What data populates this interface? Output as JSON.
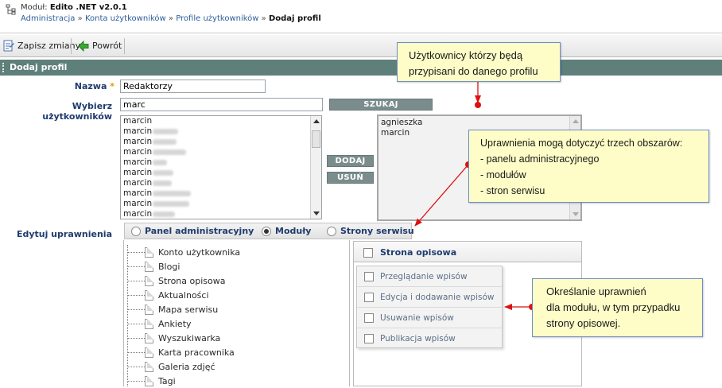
{
  "header": {
    "module_label": "Moduł:",
    "module_name": "Edito .NET v2.0.1",
    "breadcrumbs": [
      "Administracja",
      "Konta użytkowników",
      "Profile użytkowników"
    ],
    "breadcrumb_sep": "»",
    "breadcrumb_current": "Dodaj profil"
  },
  "toolbar": {
    "save_label": "Zapisz zmiany",
    "back_label": "Powrót"
  },
  "section": {
    "title": "Dodaj profil"
  },
  "form": {
    "name_label": "Nazwa",
    "name_required_mark": "*",
    "name_value": "Redaktorzy",
    "users_label": "Wybierz użytkowników",
    "search_value": "marc",
    "search_button": "SZUKAJ",
    "add_button": "DODAJ",
    "remove_button": "USUŃ",
    "available_users": [
      "marcin",
      "marcin",
      "marcin",
      "marcin",
      "marcin",
      "marcin",
      "marcin",
      "marcin",
      "marcin",
      "marcin"
    ],
    "selected_users": [
      "agnieszka",
      "marcin"
    ],
    "permissions_label": "Edytuj uprawnienia"
  },
  "permissions": {
    "options": [
      "Panel administracyjny",
      "Moduły",
      "Strony serwisu"
    ],
    "selected": "Moduły",
    "modules": [
      "Konto użytkownika",
      "Blogi",
      "Strona opisowa",
      "Aktualności",
      "Mapa serwisu",
      "Ankiety",
      "Wyszukiwarka",
      "Karta pracownika",
      "Galeria zdjęć",
      "Tagi"
    ],
    "panel_title": "Strona opisowa",
    "rights": [
      "Przeglądanie wpisów",
      "Edycja i dodawanie wpisów",
      "Usuwanie wpisów",
      "Publikacja wpisów"
    ]
  },
  "callouts": {
    "users": [
      "Użytkownicy którzy będą",
      "przypisani do danego profilu"
    ],
    "areas": [
      "Uprawnienia mogą dotyczyć trzech obszarów:",
      "- panelu administracyjnego",
      "- modułów",
      "- stron serwisu"
    ],
    "module_rights": [
      "Określanie uprawnień",
      "dla modułu, w tym przypadku",
      "strony opisowej."
    ]
  },
  "colors": {
    "section_bg": "#5f7f7a",
    "label_blue": "#1f3c6e",
    "callout_bg": "#fefdc8",
    "annotation_red": "#dd1111"
  }
}
